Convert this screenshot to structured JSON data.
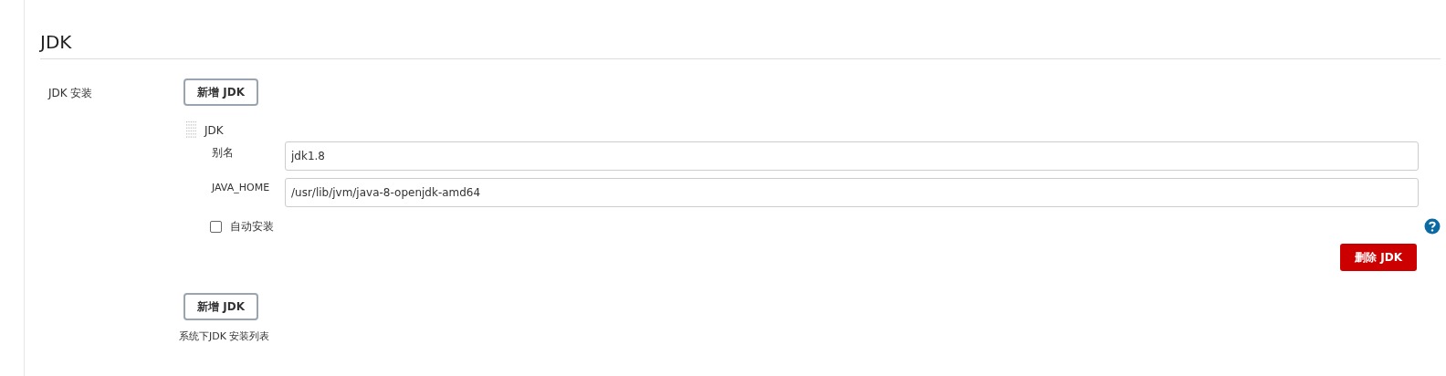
{
  "section": {
    "title": "JDK"
  },
  "installations": {
    "label": "JDK 安装",
    "add_button": "新增 JDK",
    "items": [
      {
        "title": "JDK",
        "alias_label": "别名",
        "alias_value": "jdk1.8",
        "home_label": "JAVA_HOME",
        "home_value": "/usr/lib/jvm/java-8-openjdk-amd64",
        "auto_install": {
          "label": "自动安装",
          "checked": false
        },
        "delete_button": "删除 JDK"
      }
    ],
    "add_button_bottom": "新增 JDK",
    "description": "系统下JDK 安装列表"
  }
}
